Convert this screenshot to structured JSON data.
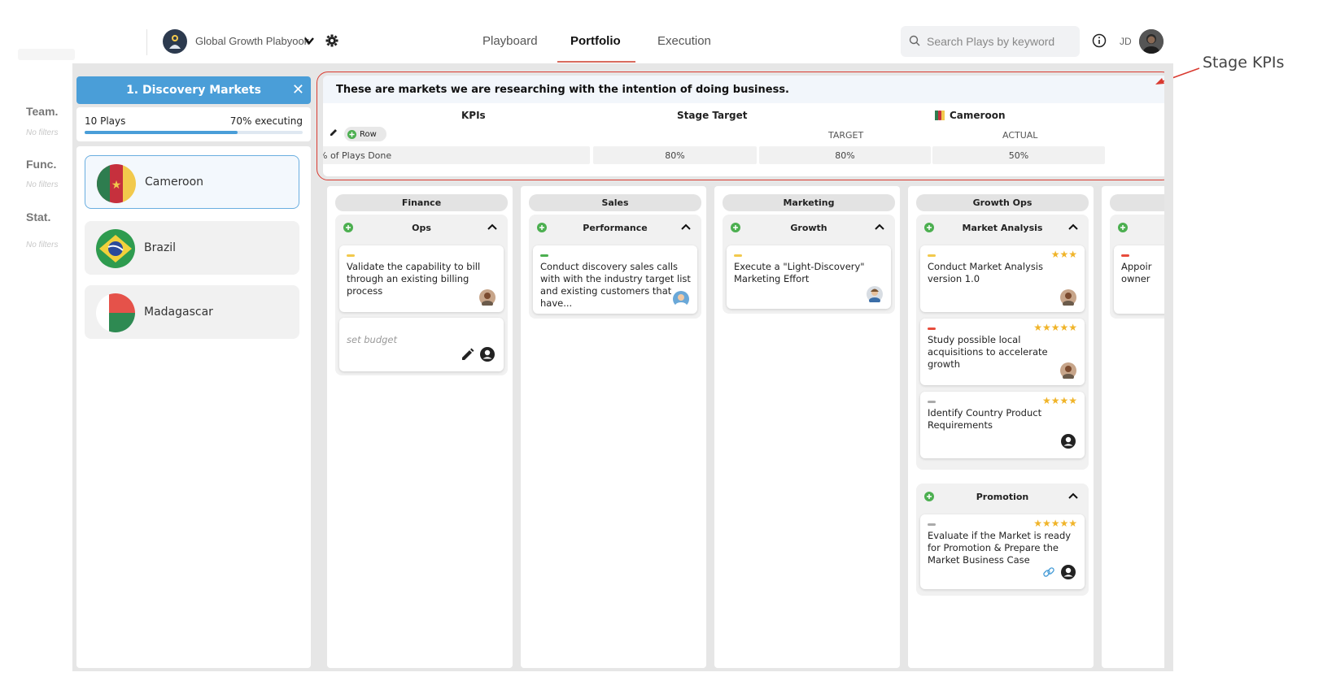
{
  "header": {
    "brand": "Global Growth Plabyook",
    "tabs": [
      {
        "label": "Playboard",
        "active": false
      },
      {
        "label": "Portfolio",
        "active": true
      },
      {
        "label": "Execution",
        "active": false
      }
    ],
    "search_placeholder": "Search Plays by keyword",
    "user_initials": "JD"
  },
  "filters": [
    {
      "label": "Team.",
      "sub": "No filters"
    },
    {
      "label": "Func.",
      "sub": "No filters"
    },
    {
      "label": "Stat.",
      "sub": "No filters"
    }
  ],
  "stage": {
    "title": "1. Discovery Markets",
    "plays": "10 Plays",
    "executing": "70% executing",
    "progress": 0.7
  },
  "markets": [
    {
      "name": "Cameroon",
      "selected": true
    },
    {
      "name": "Brazil",
      "selected": false
    },
    {
      "name": "Madagascar",
      "selected": false
    }
  ],
  "kpi": {
    "description": "These are markets we are researching with the intention of doing business.",
    "col_kpis": "KPIs",
    "col_stage_target": "Stage Target",
    "market": "Cameroon",
    "row_button": "Row",
    "sub_target": "TARGET",
    "sub_actual": "ACTUAL",
    "rows": [
      {
        "name": "% of Plays Done",
        "stage_target": "80%",
        "target": "80%",
        "actual": "50%"
      }
    ]
  },
  "columns": [
    {
      "title": "Finance",
      "groups": [
        {
          "title": "Ops",
          "cards": [
            {
              "text": "Validate the capability to bill through an existing billing process",
              "priority": "#f2c94c",
              "stars": ""
            },
            {
              "text": "set budget",
              "placeholder": true
            }
          ]
        }
      ]
    },
    {
      "title": "Sales",
      "groups": [
        {
          "title": "Performance",
          "cards": [
            {
              "text": "Conduct discovery sales calls with with the industry target list and existing customers that have...",
              "priority": "#4caf50",
              "stars": ""
            }
          ]
        }
      ]
    },
    {
      "title": "Marketing",
      "groups": [
        {
          "title": "Growth",
          "cards": [
            {
              "text": "Execute a \"Light-Discovery\" Marketing Effort",
              "priority": "#f2c94c",
              "stars": ""
            }
          ]
        }
      ]
    },
    {
      "title": "Growth Ops",
      "groups": [
        {
          "title": "Market Analysis",
          "cards": [
            {
              "text": "Conduct Market Analysis version 1.0",
              "priority": "#f2c94c",
              "stars": "★★★"
            },
            {
              "text": "Study possible local acquisitions to accelerate growth",
              "priority": "#e74c3c",
              "stars": "★★★★★"
            },
            {
              "text": "Identify Country Product Requirements",
              "priority": "#aaaaaa",
              "stars": "★★★★"
            }
          ]
        },
        {
          "title": "Promotion",
          "cards": [
            {
              "text": "Evaluate if the Market is ready for Promotion & Prepare the Market Business Case",
              "priority": "#aaaaaa",
              "stars": "★★★★★"
            }
          ]
        }
      ]
    },
    {
      "title": "",
      "groups": [
        {
          "title": "",
          "cards": [
            {
              "text": "Appoir owner",
              "priority": "#e74c3c",
              "stars": ""
            }
          ]
        }
      ]
    }
  ],
  "annotation": {
    "label": "Stage KPIs"
  },
  "colors": {
    "accent_blue": "#4a9ed8",
    "nav_underline": "#d86b5e",
    "annotation_red": "#d93a30",
    "star": "#f0b429"
  }
}
